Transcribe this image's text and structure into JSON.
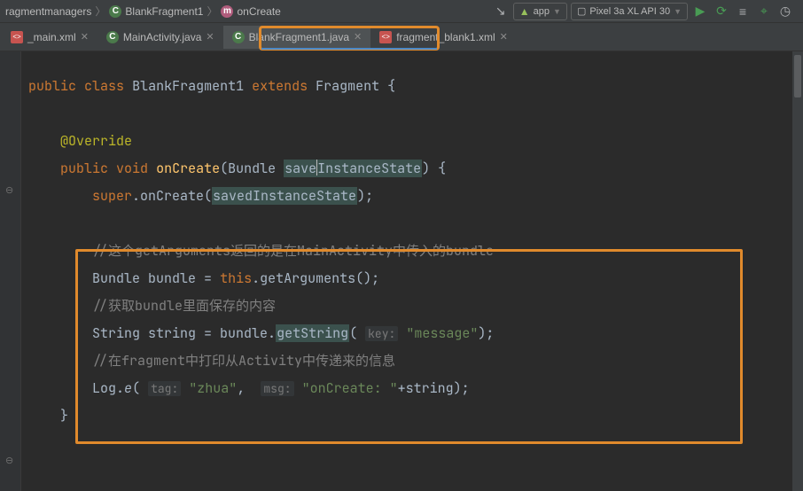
{
  "breadcrumb": {
    "pkg": "ragmentmanagers",
    "class": "BlankFragment1",
    "method": "onCreate"
  },
  "runConfig": {
    "module": "app",
    "device": "Pixel 3a XL API 30"
  },
  "tabs": [
    {
      "label": "_main.xml",
      "type": "xml",
      "active": false
    },
    {
      "label": "MainActivity.java",
      "type": "class",
      "active": false
    },
    {
      "label": "BlankFragment1.java",
      "type": "class",
      "active": true
    },
    {
      "label": "fragment_blank1.xml",
      "type": "xml",
      "active": false
    }
  ],
  "code": {
    "kw_public": "public",
    "kw_class": "class",
    "className": "BlankFragment1",
    "kw_extends": "extends",
    "superClass": "Fragment",
    "brace_open": "{",
    "annotation": "@Override",
    "kw_void": "void",
    "method": "onCreate",
    "paramType": "Bundle",
    "paramPrefix": "save",
    "paramSuffix": "InstanceState",
    "brace_paren_open": ") {",
    "super": "super",
    "superCall": ".onCreate(",
    "superArg": "savedInstanceState",
    "close_paren_semi": ");",
    "comment1": "//这个getArguments返回的是在MainActivity中传入的bundle",
    "bundle_decl_type": "Bundle",
    "bundle_decl_name": "bundle = ",
    "kw_this": "this",
    "getArgsCall": ".getArguments();",
    "comment2": "//获取bundle里面保存的内容",
    "string_decl_type": "String",
    "string_decl_eq": "string = bundle.",
    "getString": "getString",
    "hint_key": "key:",
    "key_literal": "\"message\"",
    "close2": ");",
    "comment3": "//在fragment中打印从Activity中传递来的信息",
    "log_pre": "Log.",
    "log_e": "e",
    "paren_open": "(",
    "hint_tag": "tag:",
    "tag_literal": "\"zhua\"",
    "comma": ",",
    "hint_msg": "msg:",
    "msg_literal": "\"onCreate: \"",
    "plus_string": "+string);",
    "brace_close": "}"
  }
}
